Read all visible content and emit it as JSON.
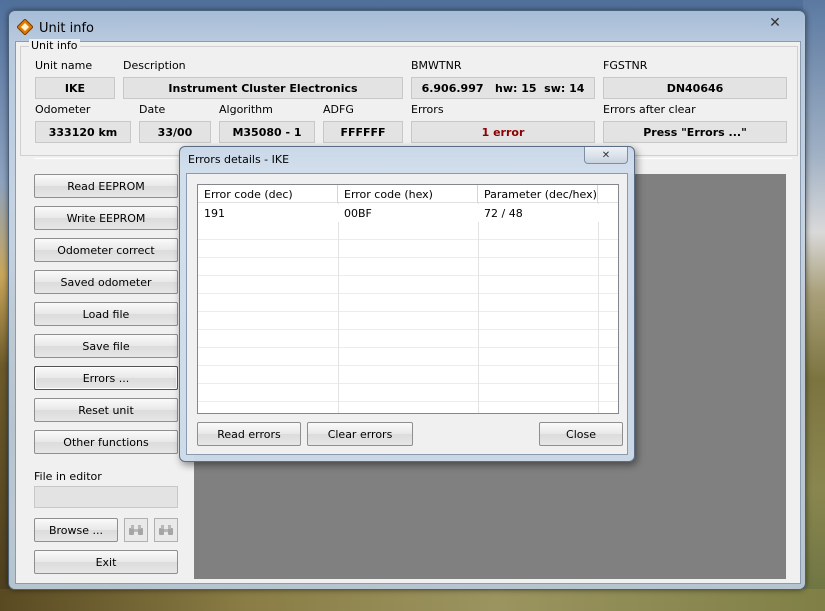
{
  "window": {
    "title": "Unit info",
    "close_glyph": "✕"
  },
  "unit_info": {
    "legend": "Unit info",
    "unit_name_label": "Unit name",
    "unit_name": "IKE",
    "description_label": "Description",
    "description": "Instrument Cluster Electronics",
    "bmwtnr_label": "BMWTNR",
    "bmwtnr": "6.906.997   hw: 15  sw: 14",
    "fgstnr_label": "FGSTNR",
    "fgstnr": "DN40646",
    "odometer_label": "Odometer",
    "odometer": "333120 km",
    "date_label": "Date",
    "date": "33/00",
    "algorithm_label": "Algorithm",
    "algorithm": "M35080 - 1",
    "adfg_label": "ADFG",
    "adfg": "FFFFFF",
    "errors_label": "Errors",
    "errors": "1 error",
    "errors_after_clear_label": "Errors after clear",
    "errors_after_clear": "Press \"Errors ...\""
  },
  "sidebar": {
    "buttons": [
      "Read EEPROM",
      "Write EEPROM",
      "Odometer correct",
      "Saved odometer",
      "Load file",
      "Save file",
      "Errors ...",
      "Reset unit",
      "Other functions"
    ],
    "file_in_editor_label": "File in editor",
    "file_in_editor": "",
    "browse_label": "Browse ...",
    "exit_label": "Exit",
    "icons": [
      "binoculars-icon",
      "binoculars-next-icon"
    ]
  },
  "dialog": {
    "title": "Errors details - IKE",
    "close_glyph": "✕",
    "columns": [
      "Error code (dec)",
      "Error code (hex)",
      "Parameter (dec/hex)"
    ],
    "rows": [
      [
        "191",
        "00BF",
        "72 / 48"
      ]
    ],
    "read_errors_label": "Read errors",
    "clear_errors_label": "Clear errors",
    "close_label": "Close"
  },
  "colors": {
    "error_text": "#8b0000",
    "panel_gray": "#808080"
  }
}
